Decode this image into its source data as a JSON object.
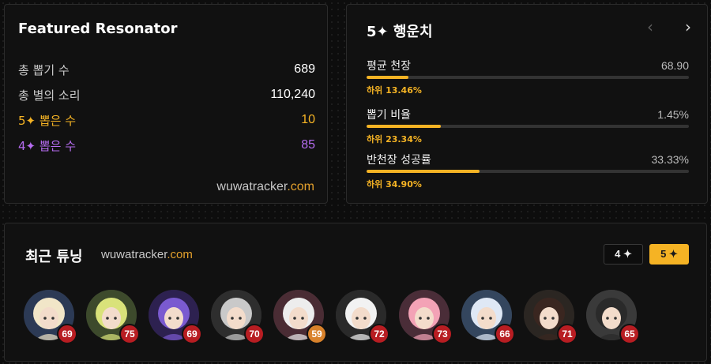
{
  "featured": {
    "title": "Featured Resonator",
    "stats": [
      {
        "label": "총 뽑기 수",
        "value": "689",
        "tone": "normal"
      },
      {
        "label": "총 별의 소리",
        "value": "110,240",
        "tone": "normal"
      },
      {
        "label": "5✦ 뽑은 수",
        "value": "10",
        "tone": "gold"
      },
      {
        "label": "4✦ 뽑은 수",
        "value": "85",
        "tone": "purple"
      }
    ],
    "watermark_name": "wuwatracker",
    "watermark_tld": ".com"
  },
  "pity": {
    "title": "5✦ 행운치",
    "prev_icon": "‹",
    "next_icon": "›",
    "items": [
      {
        "label": "평균 천장",
        "value": "68.90",
        "rank": "하위 13.46%",
        "progress": 0.13
      },
      {
        "label": "뽑기 비율",
        "value": "1.45%",
        "rank": "하위 23.34%",
        "progress": 0.23
      },
      {
        "label": "반천장 성공률",
        "value": "33.33%",
        "rank": "하위 34.90%",
        "progress": 0.35
      }
    ]
  },
  "tuning": {
    "title": "최근 튜닝",
    "watermark_name": "wuwatracker",
    "watermark_tld": ".com",
    "filter_4": "4 ✦",
    "filter_5": "5 ✦",
    "avatars": [
      {
        "pulls": "69",
        "badge_color": "#b81d22",
        "hair": "#f1e6c8",
        "bg": "#2c3a55"
      },
      {
        "pulls": "75",
        "badge_color": "#b81d22",
        "hair": "#d9e27a",
        "bg": "#3d4a2c"
      },
      {
        "pulls": "69",
        "badge_color": "#b81d22",
        "hair": "#7a5ad0",
        "bg": "#2d2150"
      },
      {
        "pulls": "70",
        "badge_color": "#b81d22",
        "hair": "#c9c9c9",
        "bg": "#2e2e2e"
      },
      {
        "pulls": "59",
        "badge_color": "#d9822b",
        "hair": "#ededed",
        "bg": "#4a2c34"
      },
      {
        "pulls": "72",
        "badge_color": "#b81d22",
        "hair": "#f2f2f2",
        "bg": "#2a2a2a"
      },
      {
        "pulls": "73",
        "badge_color": "#b81d22",
        "hair": "#f3a2b6",
        "bg": "#4a2d38"
      },
      {
        "pulls": "66",
        "badge_color": "#b81d22",
        "hair": "#dfe8f5",
        "bg": "#34465e"
      },
      {
        "pulls": "71",
        "badge_color": "#b81d22",
        "hair": "#3a2620",
        "bg": "#2b2622"
      },
      {
        "pulls": "65",
        "badge_color": "#b81d22",
        "hair": "#2a2a2a",
        "bg": "#3a3a3a"
      }
    ]
  }
}
